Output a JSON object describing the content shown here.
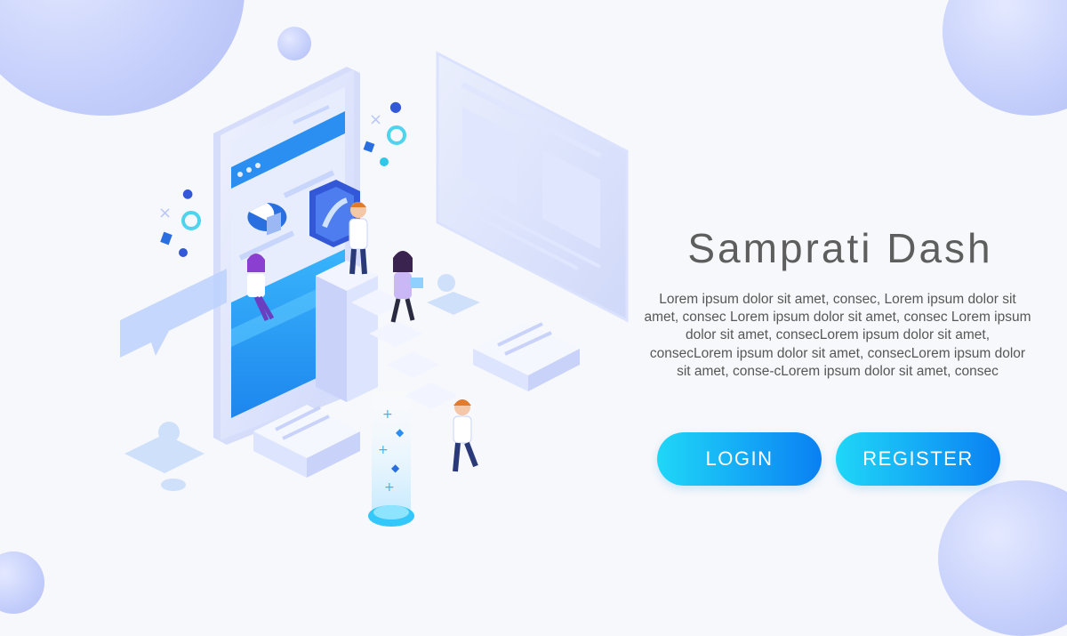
{
  "hero": {
    "title": "Samprati Dash",
    "description": "Lorem ipsum dolor sit amet, consec, Lorem ipsum dolor sit amet, consec Lorem ipsum dolor sit amet, consec Lorem ipsum dolor sit amet, consecLorem ipsum dolor sit amet, consecLorem ipsum dolor sit amet, consecLorem ipsum dolor sit amet, conse-cLorem ipsum dolor sit amet, consec"
  },
  "buttons": {
    "login_label": "LOGIN",
    "register_label": "REGISTER"
  },
  "colors": {
    "background": "#f7f8fb",
    "button_gradient_start": "#1fd7f7",
    "button_gradient_end": "#0a80f2",
    "title_color": "#5e5e5e",
    "bubble_color": "#c6d0fb",
    "illustration_accent": "#2a8ff0"
  },
  "illustration": {
    "subject": "isometric-mobile-dashboard-with-people-icon"
  }
}
